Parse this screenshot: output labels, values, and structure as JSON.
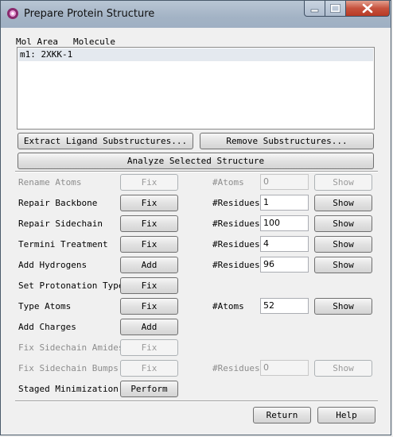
{
  "window": {
    "title": "Prepare Protein Structure"
  },
  "molecule_list": {
    "header_area": "Mol Area",
    "header_molecule": "Molecule",
    "items": [
      "m1: 2XKK-1"
    ]
  },
  "buttons": {
    "extract": "Extract Ligand Substructures...",
    "remove": "Remove Substructures...",
    "analyze": "Analyze Selected Structure",
    "return": "Return",
    "help": "Help"
  },
  "rows": [
    {
      "label": "Rename Atoms",
      "action": "Fix",
      "count_label": "#Atoms",
      "count": "0",
      "show": "Show",
      "enabled": false
    },
    {
      "label": "Repair Backbone",
      "action": "Fix",
      "count_label": "#Residues",
      "count": "1",
      "show": "Show",
      "enabled": true
    },
    {
      "label": "Repair Sidechain",
      "action": "Fix",
      "count_label": "#Residues",
      "count": "100",
      "show": "Show",
      "enabled": true
    },
    {
      "label": "Termini Treatment",
      "action": "Fix",
      "count_label": "#Residues",
      "count": "4",
      "show": "Show",
      "enabled": true
    },
    {
      "label": "Add Hydrogens",
      "action": "Add",
      "count_label": "#Residues",
      "count": "96",
      "show": "Show",
      "enabled": true
    },
    {
      "label": "Set Protonation Type",
      "action": "Fix",
      "enabled": true
    },
    {
      "label": "Type Atoms",
      "action": "Fix",
      "count_label": "#Atoms",
      "count": "52",
      "show": "Show",
      "enabled": true
    },
    {
      "label": "Add Charges",
      "action": "Add",
      "enabled": true
    },
    {
      "label": "Fix Sidechain Amides",
      "action": "Fix",
      "enabled": false
    },
    {
      "label": "Fix Sidechain Bumps",
      "action": "Fix",
      "count_label": "#Residues",
      "count": "0",
      "show": "Show",
      "enabled": false
    },
    {
      "label": "Staged Minimization",
      "action": "Perform",
      "enabled": true
    }
  ]
}
